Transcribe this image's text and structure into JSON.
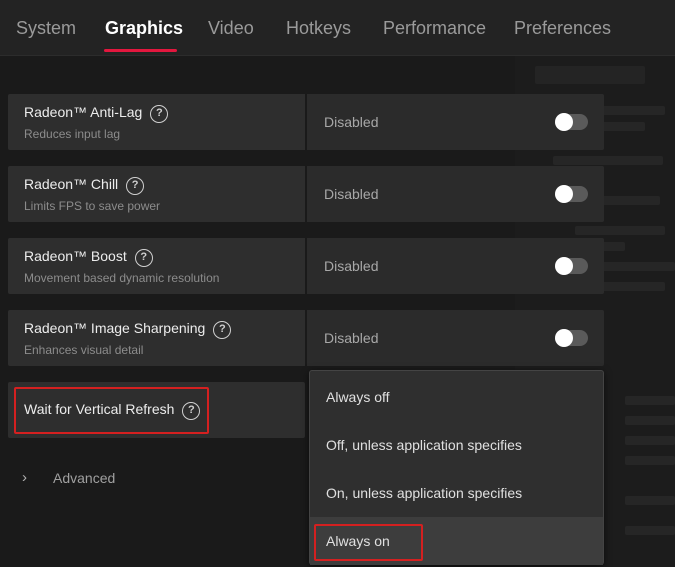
{
  "nav": {
    "tabs": [
      {
        "label": "System"
      },
      {
        "label": "Graphics"
      },
      {
        "label": "Video"
      },
      {
        "label": "Hotkeys"
      },
      {
        "label": "Performance"
      },
      {
        "label": "Preferences"
      }
    ],
    "active_tab": "Graphics",
    "accent_color": "#e3173e"
  },
  "settings": [
    {
      "title": "Radeon™ Anti-Lag",
      "description": "Reduces input lag",
      "value": "Disabled",
      "enabled": false
    },
    {
      "title": "Radeon™ Chill",
      "description": "Limits FPS to save power",
      "value": "Disabled",
      "enabled": false
    },
    {
      "title": "Radeon™ Boost",
      "description": "Movement based dynamic resolution",
      "value": "Disabled",
      "enabled": false
    },
    {
      "title": "Radeon™ Image Sharpening",
      "description": "Enhances visual detail",
      "value": "Disabled",
      "enabled": false
    }
  ],
  "help_glyph": "?",
  "vsync": {
    "label": "Wait for Vertical Refresh",
    "options": [
      "Always off",
      "Off, unless application specifies",
      "On, unless application specifies",
      "Always on"
    ],
    "selected": "Always on"
  },
  "advanced": {
    "label": "Advanced",
    "icon": "chevron-right-icon"
  },
  "highlight_color": "#d42020"
}
